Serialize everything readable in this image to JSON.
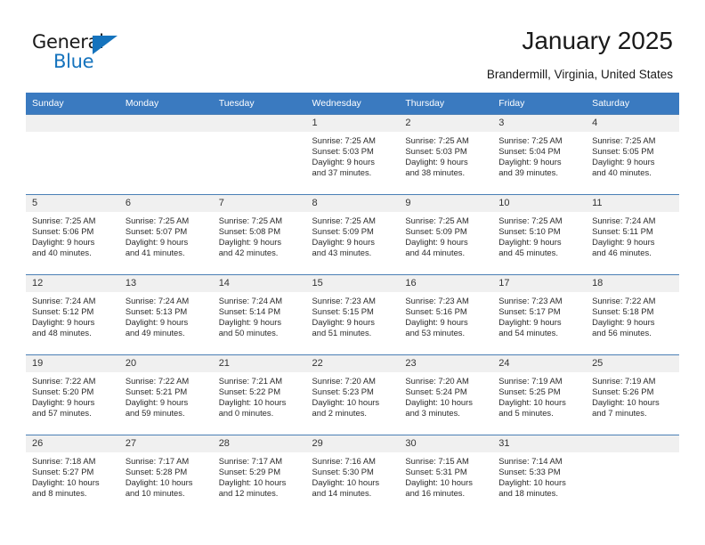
{
  "brand": {
    "name_part1": "General",
    "name_part2": "Blue",
    "accent_color": "#1573bd"
  },
  "header": {
    "title": "January 2025",
    "subtitle": "Brandermill, Virginia, United States",
    "header_bg_color": "#3a7ac0"
  },
  "weekdays": [
    "Sunday",
    "Monday",
    "Tuesday",
    "Wednesday",
    "Thursday",
    "Friday",
    "Saturday"
  ],
  "weeks": [
    [
      {
        "day": "",
        "empty": true
      },
      {
        "day": "",
        "empty": true
      },
      {
        "day": "",
        "empty": true
      },
      {
        "day": "1",
        "sunrise": "Sunrise: 7:25 AM",
        "sunset": "Sunset: 5:03 PM",
        "daylight1": "Daylight: 9 hours",
        "daylight2": "and 37 minutes."
      },
      {
        "day": "2",
        "sunrise": "Sunrise: 7:25 AM",
        "sunset": "Sunset: 5:03 PM",
        "daylight1": "Daylight: 9 hours",
        "daylight2": "and 38 minutes."
      },
      {
        "day": "3",
        "sunrise": "Sunrise: 7:25 AM",
        "sunset": "Sunset: 5:04 PM",
        "daylight1": "Daylight: 9 hours",
        "daylight2": "and 39 minutes."
      },
      {
        "day": "4",
        "sunrise": "Sunrise: 7:25 AM",
        "sunset": "Sunset: 5:05 PM",
        "daylight1": "Daylight: 9 hours",
        "daylight2": "and 40 minutes."
      }
    ],
    [
      {
        "day": "5",
        "sunrise": "Sunrise: 7:25 AM",
        "sunset": "Sunset: 5:06 PM",
        "daylight1": "Daylight: 9 hours",
        "daylight2": "and 40 minutes."
      },
      {
        "day": "6",
        "sunrise": "Sunrise: 7:25 AM",
        "sunset": "Sunset: 5:07 PM",
        "daylight1": "Daylight: 9 hours",
        "daylight2": "and 41 minutes."
      },
      {
        "day": "7",
        "sunrise": "Sunrise: 7:25 AM",
        "sunset": "Sunset: 5:08 PM",
        "daylight1": "Daylight: 9 hours",
        "daylight2": "and 42 minutes."
      },
      {
        "day": "8",
        "sunrise": "Sunrise: 7:25 AM",
        "sunset": "Sunset: 5:09 PM",
        "daylight1": "Daylight: 9 hours",
        "daylight2": "and 43 minutes."
      },
      {
        "day": "9",
        "sunrise": "Sunrise: 7:25 AM",
        "sunset": "Sunset: 5:09 PM",
        "daylight1": "Daylight: 9 hours",
        "daylight2": "and 44 minutes."
      },
      {
        "day": "10",
        "sunrise": "Sunrise: 7:25 AM",
        "sunset": "Sunset: 5:10 PM",
        "daylight1": "Daylight: 9 hours",
        "daylight2": "and 45 minutes."
      },
      {
        "day": "11",
        "sunrise": "Sunrise: 7:24 AM",
        "sunset": "Sunset: 5:11 PM",
        "daylight1": "Daylight: 9 hours",
        "daylight2": "and 46 minutes."
      }
    ],
    [
      {
        "day": "12",
        "sunrise": "Sunrise: 7:24 AM",
        "sunset": "Sunset: 5:12 PM",
        "daylight1": "Daylight: 9 hours",
        "daylight2": "and 48 minutes."
      },
      {
        "day": "13",
        "sunrise": "Sunrise: 7:24 AM",
        "sunset": "Sunset: 5:13 PM",
        "daylight1": "Daylight: 9 hours",
        "daylight2": "and 49 minutes."
      },
      {
        "day": "14",
        "sunrise": "Sunrise: 7:24 AM",
        "sunset": "Sunset: 5:14 PM",
        "daylight1": "Daylight: 9 hours",
        "daylight2": "and 50 minutes."
      },
      {
        "day": "15",
        "sunrise": "Sunrise: 7:23 AM",
        "sunset": "Sunset: 5:15 PM",
        "daylight1": "Daylight: 9 hours",
        "daylight2": "and 51 minutes."
      },
      {
        "day": "16",
        "sunrise": "Sunrise: 7:23 AM",
        "sunset": "Sunset: 5:16 PM",
        "daylight1": "Daylight: 9 hours",
        "daylight2": "and 53 minutes."
      },
      {
        "day": "17",
        "sunrise": "Sunrise: 7:23 AM",
        "sunset": "Sunset: 5:17 PM",
        "daylight1": "Daylight: 9 hours",
        "daylight2": "and 54 minutes."
      },
      {
        "day": "18",
        "sunrise": "Sunrise: 7:22 AM",
        "sunset": "Sunset: 5:18 PM",
        "daylight1": "Daylight: 9 hours",
        "daylight2": "and 56 minutes."
      }
    ],
    [
      {
        "day": "19",
        "sunrise": "Sunrise: 7:22 AM",
        "sunset": "Sunset: 5:20 PM",
        "daylight1": "Daylight: 9 hours",
        "daylight2": "and 57 minutes."
      },
      {
        "day": "20",
        "sunrise": "Sunrise: 7:22 AM",
        "sunset": "Sunset: 5:21 PM",
        "daylight1": "Daylight: 9 hours",
        "daylight2": "and 59 minutes."
      },
      {
        "day": "21",
        "sunrise": "Sunrise: 7:21 AM",
        "sunset": "Sunset: 5:22 PM",
        "daylight1": "Daylight: 10 hours",
        "daylight2": "and 0 minutes."
      },
      {
        "day": "22",
        "sunrise": "Sunrise: 7:20 AM",
        "sunset": "Sunset: 5:23 PM",
        "daylight1": "Daylight: 10 hours",
        "daylight2": "and 2 minutes."
      },
      {
        "day": "23",
        "sunrise": "Sunrise: 7:20 AM",
        "sunset": "Sunset: 5:24 PM",
        "daylight1": "Daylight: 10 hours",
        "daylight2": "and 3 minutes."
      },
      {
        "day": "24",
        "sunrise": "Sunrise: 7:19 AM",
        "sunset": "Sunset: 5:25 PM",
        "daylight1": "Daylight: 10 hours",
        "daylight2": "and 5 minutes."
      },
      {
        "day": "25",
        "sunrise": "Sunrise: 7:19 AM",
        "sunset": "Sunset: 5:26 PM",
        "daylight1": "Daylight: 10 hours",
        "daylight2": "and 7 minutes."
      }
    ],
    [
      {
        "day": "26",
        "sunrise": "Sunrise: 7:18 AM",
        "sunset": "Sunset: 5:27 PM",
        "daylight1": "Daylight: 10 hours",
        "daylight2": "and 8 minutes."
      },
      {
        "day": "27",
        "sunrise": "Sunrise: 7:17 AM",
        "sunset": "Sunset: 5:28 PM",
        "daylight1": "Daylight: 10 hours",
        "daylight2": "and 10 minutes."
      },
      {
        "day": "28",
        "sunrise": "Sunrise: 7:17 AM",
        "sunset": "Sunset: 5:29 PM",
        "daylight1": "Daylight: 10 hours",
        "daylight2": "and 12 minutes."
      },
      {
        "day": "29",
        "sunrise": "Sunrise: 7:16 AM",
        "sunset": "Sunset: 5:30 PM",
        "daylight1": "Daylight: 10 hours",
        "daylight2": "and 14 minutes."
      },
      {
        "day": "30",
        "sunrise": "Sunrise: 7:15 AM",
        "sunset": "Sunset: 5:31 PM",
        "daylight1": "Daylight: 10 hours",
        "daylight2": "and 16 minutes."
      },
      {
        "day": "31",
        "sunrise": "Sunrise: 7:14 AM",
        "sunset": "Sunset: 5:33 PM",
        "daylight1": "Daylight: 10 hours",
        "daylight2": "and 18 minutes."
      },
      {
        "day": "",
        "empty": true
      }
    ]
  ]
}
